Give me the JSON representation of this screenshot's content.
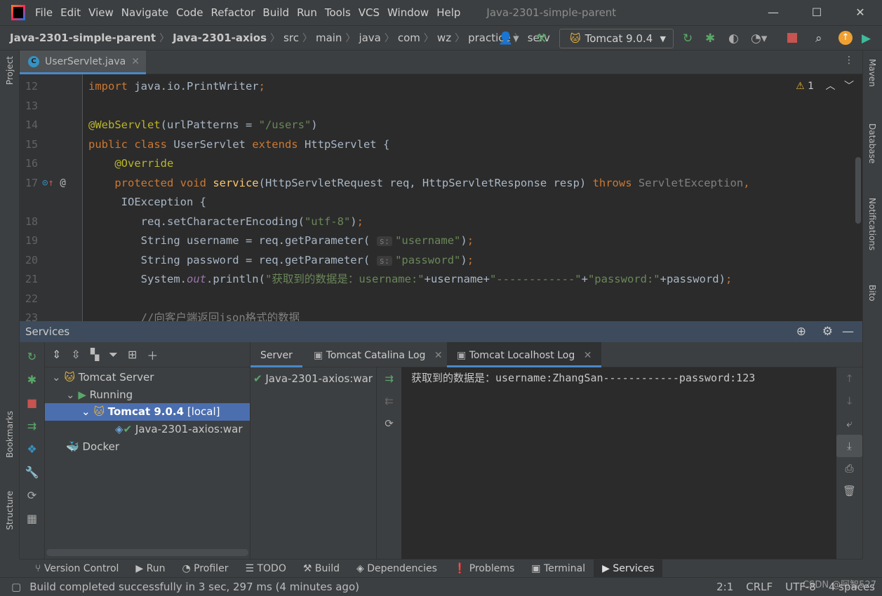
{
  "window": {
    "title": "Java-2301-simple-parent",
    "menu": [
      "File",
      "Edit",
      "View",
      "Navigate",
      "Code",
      "Refactor",
      "Build",
      "Run",
      "Tools",
      "VCS",
      "Window",
      "Help"
    ],
    "controls": [
      "—",
      "☐",
      "✕"
    ]
  },
  "breadcrumbs": [
    "Java-2301-simple-parent",
    "Java-2301-axios",
    "src",
    "main",
    "java",
    "com",
    "wz",
    "practice",
    "serv"
  ],
  "run_config": "Tomcat 9.0.4",
  "left_strip": [
    "Project",
    "Bookmarks",
    "Structure"
  ],
  "right_strip": [
    "Maven",
    "Database",
    "Notifications",
    "Bito"
  ],
  "editor": {
    "tab": "UserServlet.java",
    "warnings": "1",
    "lines": [
      {
        "n": "12",
        "t": [
          [
            "kw",
            "import "
          ],
          [
            "txt",
            "java.io.PrintWriter"
          ],
          [
            "kw",
            ";"
          ]
        ]
      },
      {
        "n": "13",
        "t": []
      },
      {
        "n": "14",
        "t": [
          [
            "an",
            "@WebServlet"
          ],
          [
            "txt",
            "(urlPatterns = "
          ],
          [
            "str",
            "\"/users\""
          ],
          [
            "txt",
            ")"
          ]
        ]
      },
      {
        "n": "15",
        "t": [
          [
            "kw",
            "public class "
          ],
          [
            "txt",
            "UserServlet "
          ],
          [
            "kw",
            "extends "
          ],
          [
            "txt",
            "HttpServlet {"
          ]
        ]
      },
      {
        "n": "16",
        "t": [
          [
            "txt",
            "    "
          ],
          [
            "an",
            "@Override"
          ]
        ]
      },
      {
        "n": "17",
        "t": [
          [
            "txt",
            "    "
          ],
          [
            "kw",
            "protected void "
          ],
          [
            "fn",
            "service"
          ],
          [
            "txt",
            "(HttpServletRequest req, HttpServletResponse resp) "
          ],
          [
            "kw",
            "throws "
          ],
          [
            "ex",
            "ServletException"
          ],
          [
            "kw",
            ","
          ]
        ]
      },
      {
        "n": "",
        "t": [
          [
            "txt",
            "     IOException {"
          ]
        ]
      },
      {
        "n": "18",
        "t": [
          [
            "txt",
            "        req.setCharacterEncoding("
          ],
          [
            "str",
            "\"utf-8\""
          ],
          [
            "txt",
            ")"
          ],
          [
            "kw",
            ";"
          ]
        ]
      },
      {
        "n": "19",
        "t": [
          [
            "txt",
            "        String username = req.getParameter( "
          ],
          [
            "hint",
            "s:"
          ],
          [
            "str",
            "\"username\""
          ],
          [
            "txt",
            ")"
          ],
          [
            "kw",
            ";"
          ]
        ]
      },
      {
        "n": "20",
        "t": [
          [
            "txt",
            "        String password = req.getParameter( "
          ],
          [
            "hint",
            "s:"
          ],
          [
            "str",
            "\"password\""
          ],
          [
            "txt",
            ")"
          ],
          [
            "kw",
            ";"
          ]
        ]
      },
      {
        "n": "21",
        "t": [
          [
            "txt",
            "        System."
          ],
          [
            "st",
            "out"
          ],
          [
            "txt",
            ".println("
          ],
          [
            "str",
            "\"获取到的数据是：username:\""
          ],
          [
            "txt",
            "+username+"
          ],
          [
            "str",
            "\"------------\""
          ],
          [
            "txt",
            "+"
          ],
          [
            "str",
            "\"password:\""
          ],
          [
            "txt",
            "+password)"
          ],
          [
            "kw",
            ";"
          ]
        ]
      },
      {
        "n": "22",
        "t": []
      },
      {
        "n": "23",
        "t": [
          [
            "cm",
            "        //向客户端返回json格式的数据"
          ]
        ]
      }
    ]
  },
  "services": {
    "title": "Services",
    "tree": [
      {
        "label": "Tomcat Server",
        "icon": "tomcat-icon"
      },
      {
        "label": "Running",
        "icon": "play-icon"
      },
      {
        "label": "Tomcat 9.0.4",
        "suffix": "[local]",
        "icon": "tomcat-icon",
        "selected": true
      },
      {
        "label": "Java-2301-axios:war",
        "icon": "check-icon"
      },
      {
        "label": "Docker",
        "icon": "docker-icon"
      }
    ],
    "tabs": [
      "Server",
      "Tomcat Catalina Log",
      "Tomcat Localhost Log"
    ],
    "active_tab": "Tomcat Localhost Log",
    "deployment": "Java-2301-axios:war",
    "console_output": "获取到的数据是：username:ZhangSan------------password:123"
  },
  "bottom_tabs": [
    "Version Control",
    "Run",
    "Profiler",
    "TODO",
    "Build",
    "Dependencies",
    "Problems",
    "Terminal",
    "Services"
  ],
  "status": {
    "message": "Build completed successfully in 3 sec, 297 ms (4 minutes ago)",
    "position": "2:1",
    "line_sep": "CRLF",
    "encoding": "UTF-8",
    "indent": "4 spaces",
    "watermark": "CSDN @阿智527"
  },
  "colors": {
    "accent": "#4b6eaf",
    "keyword": "#cc7832",
    "string": "#6a8759",
    "annotation": "#bbb529"
  }
}
